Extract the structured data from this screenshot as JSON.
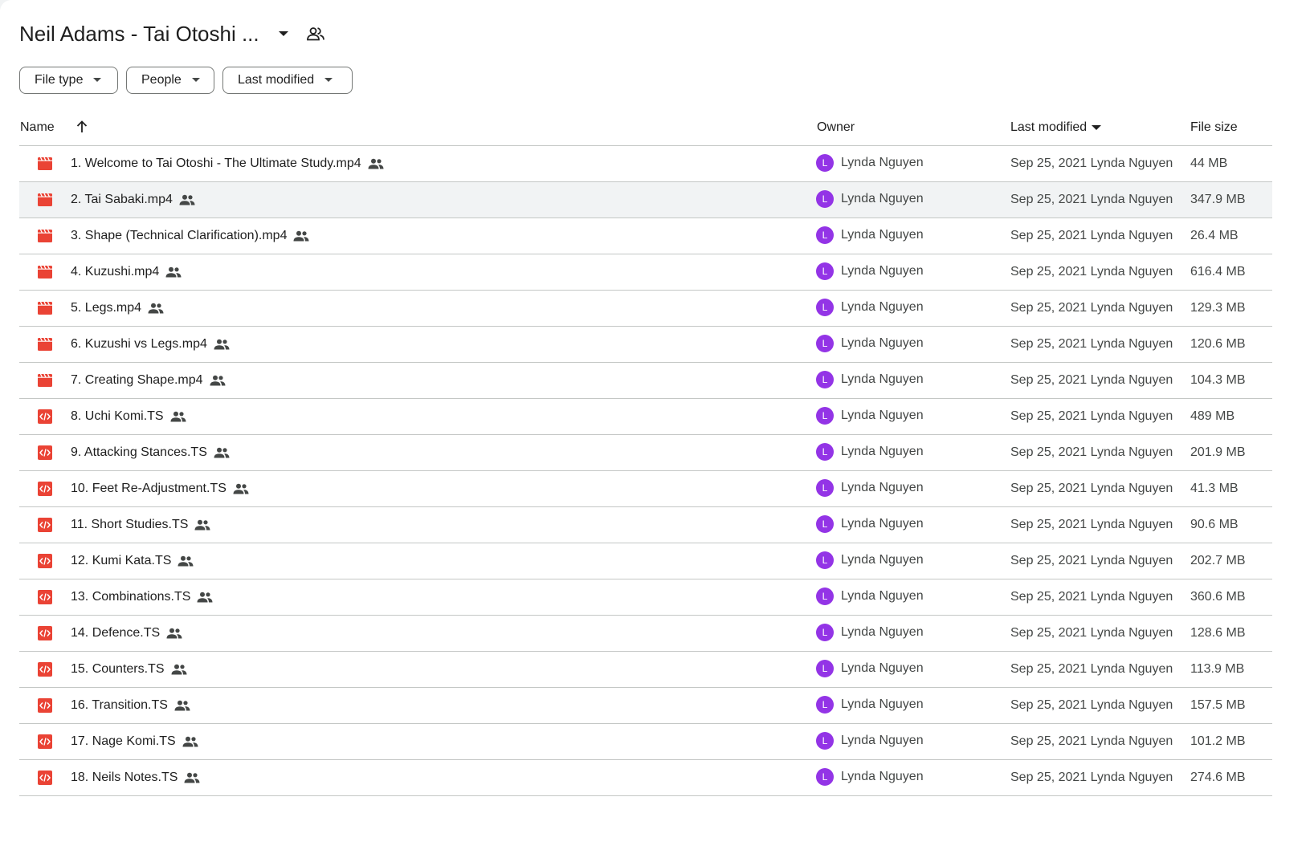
{
  "folder": {
    "title": "Neil Adams - Tai Otoshi ..."
  },
  "filters": {
    "file_type": "File type",
    "people": "People",
    "last_modified": "Last modified"
  },
  "columns": {
    "name": "Name",
    "owner": "Owner",
    "last_modified": "Last modified",
    "file_size": "File size"
  },
  "icons": {
    "video": "video-file-icon",
    "code": "code-file-icon",
    "shared": "shared-people-icon",
    "sort_up": "arrow-up-icon",
    "caret": "caret-down-icon"
  },
  "colors": {
    "file_icon": "#ea4335",
    "avatar": "#9334e6",
    "selected_row": "#f1f3f4"
  },
  "selected_row_index": 1,
  "files": [
    {
      "name": "1. Welcome to Tai Otoshi - The Ultimate Study.mp4",
      "type": "video",
      "owner": "Lynda Nguyen",
      "owner_initial": "L",
      "modified": "Sep 25, 2021 Lynda Nguyen",
      "size": "44 MB"
    },
    {
      "name": "2. Tai Sabaki.mp4",
      "type": "video",
      "owner": "Lynda Nguyen",
      "owner_initial": "L",
      "modified": "Sep 25, 2021 Lynda Nguyen",
      "size": "347.9 MB"
    },
    {
      "name": "3. Shape (Technical Clarification).mp4",
      "type": "video",
      "owner": "Lynda Nguyen",
      "owner_initial": "L",
      "modified": "Sep 25, 2021 Lynda Nguyen",
      "size": "26.4 MB"
    },
    {
      "name": "4. Kuzushi.mp4",
      "type": "video",
      "owner": "Lynda Nguyen",
      "owner_initial": "L",
      "modified": "Sep 25, 2021 Lynda Nguyen",
      "size": "616.4 MB"
    },
    {
      "name": "5. Legs.mp4",
      "type": "video",
      "owner": "Lynda Nguyen",
      "owner_initial": "L",
      "modified": "Sep 25, 2021 Lynda Nguyen",
      "size": "129.3 MB"
    },
    {
      "name": "6. Kuzushi vs Legs.mp4",
      "type": "video",
      "owner": "Lynda Nguyen",
      "owner_initial": "L",
      "modified": "Sep 25, 2021 Lynda Nguyen",
      "size": "120.6 MB"
    },
    {
      "name": "7. Creating Shape.mp4",
      "type": "video",
      "owner": "Lynda Nguyen",
      "owner_initial": "L",
      "modified": "Sep 25, 2021 Lynda Nguyen",
      "size": "104.3 MB"
    },
    {
      "name": "8. Uchi Komi.TS",
      "type": "code",
      "owner": "Lynda Nguyen",
      "owner_initial": "L",
      "modified": "Sep 25, 2021 Lynda Nguyen",
      "size": "489 MB"
    },
    {
      "name": "9. Attacking Stances.TS",
      "type": "code",
      "owner": "Lynda Nguyen",
      "owner_initial": "L",
      "modified": "Sep 25, 2021 Lynda Nguyen",
      "size": "201.9 MB"
    },
    {
      "name": "10. Feet Re-Adjustment.TS",
      "type": "code",
      "owner": "Lynda Nguyen",
      "owner_initial": "L",
      "modified": "Sep 25, 2021 Lynda Nguyen",
      "size": "41.3 MB"
    },
    {
      "name": "11. Short Studies.TS",
      "type": "code",
      "owner": "Lynda Nguyen",
      "owner_initial": "L",
      "modified": "Sep 25, 2021 Lynda Nguyen",
      "size": "90.6 MB"
    },
    {
      "name": "12. Kumi Kata.TS",
      "type": "code",
      "owner": "Lynda Nguyen",
      "owner_initial": "L",
      "modified": "Sep 25, 2021 Lynda Nguyen",
      "size": "202.7 MB"
    },
    {
      "name": "13. Combinations.TS",
      "type": "code",
      "owner": "Lynda Nguyen",
      "owner_initial": "L",
      "modified": "Sep 25, 2021 Lynda Nguyen",
      "size": "360.6 MB"
    },
    {
      "name": "14. Defence.TS",
      "type": "code",
      "owner": "Lynda Nguyen",
      "owner_initial": "L",
      "modified": "Sep 25, 2021 Lynda Nguyen",
      "size": "128.6 MB"
    },
    {
      "name": "15. Counters.TS",
      "type": "code",
      "owner": "Lynda Nguyen",
      "owner_initial": "L",
      "modified": "Sep 25, 2021 Lynda Nguyen",
      "size": "113.9 MB"
    },
    {
      "name": "16. Transition.TS",
      "type": "code",
      "owner": "Lynda Nguyen",
      "owner_initial": "L",
      "modified": "Sep 25, 2021 Lynda Nguyen",
      "size": "157.5 MB"
    },
    {
      "name": "17. Nage Komi.TS",
      "type": "code",
      "owner": "Lynda Nguyen",
      "owner_initial": "L",
      "modified": "Sep 25, 2021 Lynda Nguyen",
      "size": "101.2 MB"
    },
    {
      "name": "18. Neils Notes.TS",
      "type": "code",
      "owner": "Lynda Nguyen",
      "owner_initial": "L",
      "modified": "Sep 25, 2021 Lynda Nguyen",
      "size": "274.6 MB"
    }
  ]
}
